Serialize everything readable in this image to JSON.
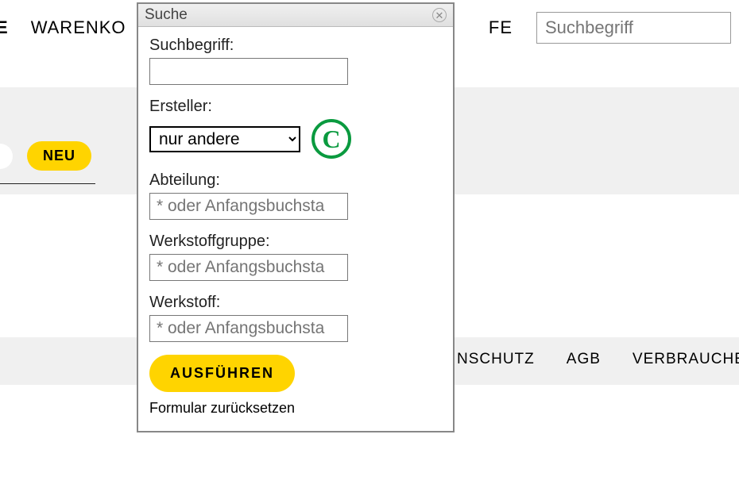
{
  "nav": {
    "bold_fragment": "E",
    "item_left": "WARENKO",
    "item_far_right": "FE",
    "search_placeholder": "Suchbegriff"
  },
  "neu_label": "NEU",
  "footer": {
    "item1": "NSCHUTZ",
    "item2": "AGB",
    "item3": "VERBRAUCHE"
  },
  "dialog": {
    "title": "Suche",
    "fields": {
      "suchbegriff_label": "Suchbegriff:",
      "suchbegriff_value": "",
      "ersteller_label": "Ersteller:",
      "ersteller_selected": "nur andere",
      "copyright_glyph": "C",
      "abteilung_label": "Abteilung:",
      "abteilung_placeholder": "* oder Anfangsbuchsta",
      "werkstoffgruppe_label": "Werkstoffgruppe:",
      "werkstoffgruppe_placeholder": "* oder Anfangsbuchsta",
      "werkstoff_label": "Werkstoff:",
      "werkstoff_placeholder": "* oder Anfangsbuchsta"
    },
    "exec_label": "AUSFÜHREN",
    "reset_label": "Formular zurücksetzen"
  }
}
